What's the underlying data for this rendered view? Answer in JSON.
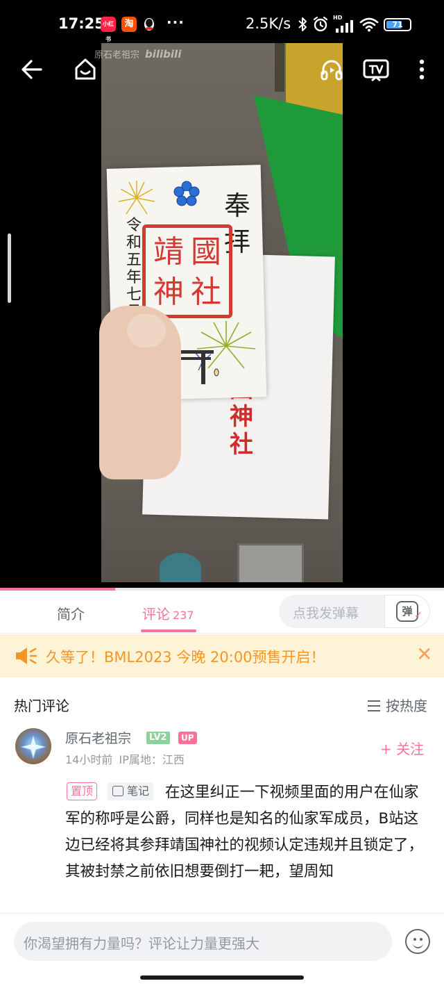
{
  "status_bar": {
    "time": "17:25",
    "apps": [
      {
        "name": "xiaohongshu-icon",
        "label": "小红书",
        "color": "#ff2442"
      },
      {
        "name": "taobao-icon",
        "label": "淘",
        "color": "#ff5000"
      },
      {
        "name": "qq-icon",
        "label": "",
        "color": "#1e1e1e"
      }
    ],
    "more": "···",
    "net_speed": "2.5K/s",
    "signal_label": "HD",
    "battery": "71"
  },
  "video": {
    "watermark_user": "原石老祖宗",
    "watermark_brand": "bilibili",
    "goshuin": {
      "date": "令和五年七月",
      "houhai": "奉拝",
      "seal": [
        "靖",
        "國",
        "神",
        "社"
      ]
    },
    "envelope_text": "國神社",
    "progress_ratio": 0.26
  },
  "tabs": {
    "intro": "简介",
    "comments": "评论",
    "comments_count": "237",
    "danmaku_placeholder": "点我发弹幕",
    "danmaku_btn": "弹"
  },
  "notice": {
    "text": "久等了！BML2023 今晚 20:00预售开启！"
  },
  "comments_section": {
    "title": "热门评论",
    "sort_label": "按热度"
  },
  "comment": {
    "username": "原石老祖宗",
    "level": "LV2",
    "up_badge": "UP",
    "time": "14小时前",
    "ip": "IP属地：江西",
    "follow": "+ 关注",
    "pinned": "置顶",
    "note": "笔记",
    "text": "在这里纠正一下视频里面的用户在仙家军的称呼是公爵，同样也是知名的仙家军成员，B站这边已经将其参拜靖国神社的视频认定违规并且锁定了，其被封禁之前依旧想要倒打一耙，望周知"
  },
  "reply_bar": {
    "placeholder": "你渴望拥有力量吗？评论让力量更强大"
  },
  "colors": {
    "accent": "#fb7299",
    "notice_text": "#f69522",
    "notice_bg": "#fdf3d7"
  }
}
